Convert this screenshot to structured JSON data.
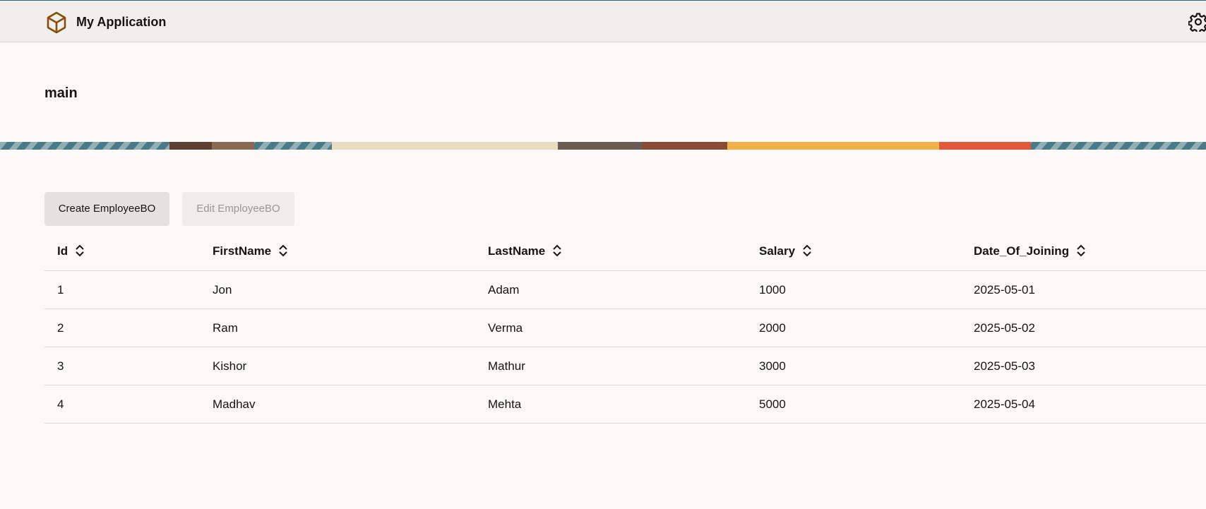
{
  "header": {
    "app_title": "My Application",
    "logo_icon": "cube-icon",
    "settings_icon": "gear-icon",
    "accent_color": "#8a4b08"
  },
  "page": {
    "title": "main"
  },
  "toolbar": {
    "create_label": "Create EmployeeBO",
    "edit_label": "Edit EmployeeBO"
  },
  "table": {
    "columns": [
      "Id",
      "FirstName",
      "LastName",
      "Salary",
      "Date_Of_Joining"
    ],
    "sort_icon": "sort-chevrons-icon",
    "rows": [
      [
        "1",
        "Jon",
        "Adam",
        "1000",
        "2025-05-01"
      ],
      [
        "2",
        "Ram",
        "Verma",
        "2000",
        "2025-05-02"
      ],
      [
        "3",
        "Kishor",
        "Mathur",
        "3000",
        "2025-05-03"
      ],
      [
        "4",
        "Madhav",
        "Mehta",
        "5000",
        "2025-05-04"
      ]
    ]
  }
}
